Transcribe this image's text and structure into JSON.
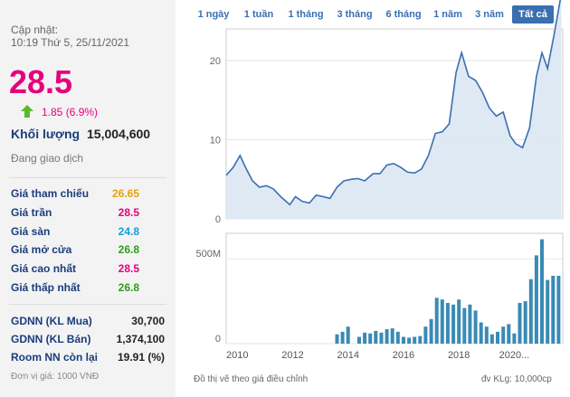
{
  "quote": {
    "updated_label": "Cập nhật:",
    "updated_time": "10:19 Thứ 5, 25/11/2021",
    "price": "28.5",
    "change": "1.85 (6.9%)",
    "volume_label": "Khối lượng",
    "volume_value": "15,004,600",
    "status": "Đang giao dịch",
    "colors": {
      "price": "#e6007e",
      "up": "#5cb82a",
      "label": "#1a3d7c"
    }
  },
  "ref_prices": [
    {
      "label": "Giá tham chiếu",
      "value": "26.65",
      "color": "#e8a20c"
    },
    {
      "label": "Giá trần",
      "value": "28.5",
      "color": "#e6007e"
    },
    {
      "label": "Giá sàn",
      "value": "24.8",
      "color": "#1a9bd7"
    },
    {
      "label": "Giá mở cửa",
      "value": "26.8",
      "color": "#2e9b1c"
    },
    {
      "label": "Giá cao nhất",
      "value": "28.5",
      "color": "#e6007e"
    },
    {
      "label": "Giá thấp nhất",
      "value": "26.8",
      "color": "#2e9b1c"
    }
  ],
  "foreign": [
    {
      "label": "GDNN (KL Mua)",
      "value": "30,700"
    },
    {
      "label": "GDNN (KL Bán)",
      "value": "1,374,100"
    },
    {
      "label": "Room NN còn lại",
      "value": "19.91 (%)"
    }
  ],
  "unit_note": "Đơn vị giá: 1000 VNĐ",
  "tabs": [
    {
      "label": "1 ngày",
      "active": false
    },
    {
      "label": "1 tuần",
      "active": false
    },
    {
      "label": "1 tháng",
      "active": false
    },
    {
      "label": "3 tháng",
      "active": false
    },
    {
      "label": "6 tháng",
      "active": false
    },
    {
      "label": "1 năm",
      "active": false
    },
    {
      "label": "3 năm",
      "active": false
    },
    {
      "label": "Tất cả",
      "active": true
    }
  ],
  "footnote": "Đồ thị vẽ theo giá điều chỉnh",
  "volume_unit": "đv KLg: 10,000cp",
  "chart_data": [
    {
      "type": "line",
      "title": "",
      "color": "#3a6fb0",
      "fill": "#dbe7f3",
      "ylim": [
        0,
        24
      ],
      "yticks": [
        0,
        10,
        20
      ],
      "x": [
        2009.6,
        2009.85,
        2010.1,
        2010.3,
        2010.55,
        2010.8,
        2011.05,
        2011.3,
        2011.6,
        2011.9,
        2012.1,
        2012.35,
        2012.6,
        2012.85,
        2013.1,
        2013.35,
        2013.6,
        2013.85,
        2014.1,
        2014.35,
        2014.6,
        2014.9,
        2015.15,
        2015.4,
        2015.65,
        2015.9,
        2016.15,
        2016.4,
        2016.65,
        2016.9,
        2017.15,
        2017.4,
        2017.65,
        2017.9,
        2018.1,
        2018.35,
        2018.6,
        2018.85,
        2019.1,
        2019.35,
        2019.6,
        2019.85,
        2020.05,
        2020.3,
        2020.55,
        2020.8,
        2021.0,
        2021.2,
        2021.45,
        2021.7
      ],
      "y": [
        5.5,
        6.5,
        8,
        6.5,
        4.8,
        4,
        4.2,
        3.8,
        2.7,
        1.8,
        2.8,
        2.2,
        2,
        3,
        2.8,
        2.6,
        4,
        4.8,
        5,
        5.1,
        4.8,
        5.7,
        5.7,
        6.8,
        7,
        6.5,
        5.9,
        5.8,
        6.3,
        8,
        10.8,
        11,
        12,
        18.5,
        21,
        18,
        17.5,
        16,
        14,
        13,
        13.5,
        10.5,
        9.5,
        9,
        11.5,
        18,
        21,
        19,
        23.5,
        28.5
      ]
    },
    {
      "type": "bar",
      "title": "",
      "color": "#3a8ab5",
      "ylim": [
        0,
        650
      ],
      "yticks": [
        0,
        500
      ],
      "ytick_labels": [
        "0",
        "500M"
      ],
      "xlim": [
        2009.6,
        2021.75
      ],
      "xticks": [
        2010,
        2012,
        2014,
        2016,
        2018,
        2020
      ],
      "xtick_labels": [
        "2010",
        "2012",
        "2014",
        "2016",
        "2018",
        "2020..."
      ],
      "x": [
        2013.6,
        2013.8,
        2014.0,
        2014.4,
        2014.6,
        2014.8,
        2015.0,
        2015.2,
        2015.4,
        2015.6,
        2015.8,
        2016.0,
        2016.2,
        2016.4,
        2016.6,
        2016.8,
        2017.0,
        2017.2,
        2017.4,
        2017.6,
        2017.8,
        2018.0,
        2018.2,
        2018.4,
        2018.6,
        2018.8,
        2019.0,
        2019.2,
        2019.4,
        2019.6,
        2019.8,
        2020.0,
        2020.2,
        2020.4,
        2020.6,
        2020.8,
        2021.0,
        2021.2,
        2021.4,
        2021.6
      ],
      "values": [
        55,
        70,
        100,
        40,
        65,
        60,
        75,
        65,
        85,
        90,
        70,
        40,
        35,
        40,
        45,
        100,
        145,
        270,
        260,
        240,
        230,
        260,
        210,
        230,
        195,
        125,
        100,
        55,
        70,
        100,
        115,
        60,
        240,
        250,
        380,
        520,
        615,
        375,
        400,
        400
      ]
    }
  ]
}
